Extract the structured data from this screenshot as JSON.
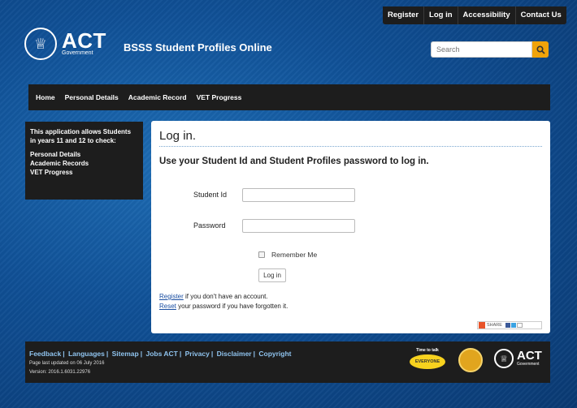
{
  "top_links": [
    "Register",
    "Log in",
    "Accessibility",
    "Contact Us"
  ],
  "logo": {
    "text": "ACT",
    "sub": "Government"
  },
  "site_title": "BSSS Student Profiles Online",
  "search": {
    "placeholder": "Search",
    "icon": "search-icon"
  },
  "nav": [
    "Home",
    "Personal Details",
    "Academic Record",
    "VET Progress"
  ],
  "sidebar": {
    "intro": "This application allows Students in years 11 and 12 to check:",
    "items": [
      "Personal Details",
      "Academic Records",
      "VET Progress"
    ]
  },
  "main": {
    "title": "Log in.",
    "subtitle": "Use your Student Id and Student Profiles password to log in.",
    "student_id_label": "Student Id",
    "password_label": "Password",
    "remember_label": "Remember Me",
    "login_button": "Log in",
    "register_link": "Register",
    "register_rest": " if you don't have an account.",
    "reset_link": "Reset",
    "reset_rest": " your password if you have forgotten it.",
    "share_label": "SHARE"
  },
  "footer": {
    "links": [
      "Feedback",
      "Languages",
      "Sitemap",
      "Jobs ACT",
      "Privacy",
      "Disclaimer",
      "Copyright"
    ],
    "updated": "Page last updated on 06 July 2016",
    "version": "Version: 2016.1.6031.22976",
    "badge1_title": "Time to talk",
    "badge1_text": "EVERYONE",
    "badge3_text": "ACT",
    "badge3_sub": "Government"
  },
  "colors": {
    "accent": "#f0a30a",
    "link": "#1a4ea1",
    "footer_link": "#8fc3ee",
    "panel": "#1d1d1d"
  }
}
